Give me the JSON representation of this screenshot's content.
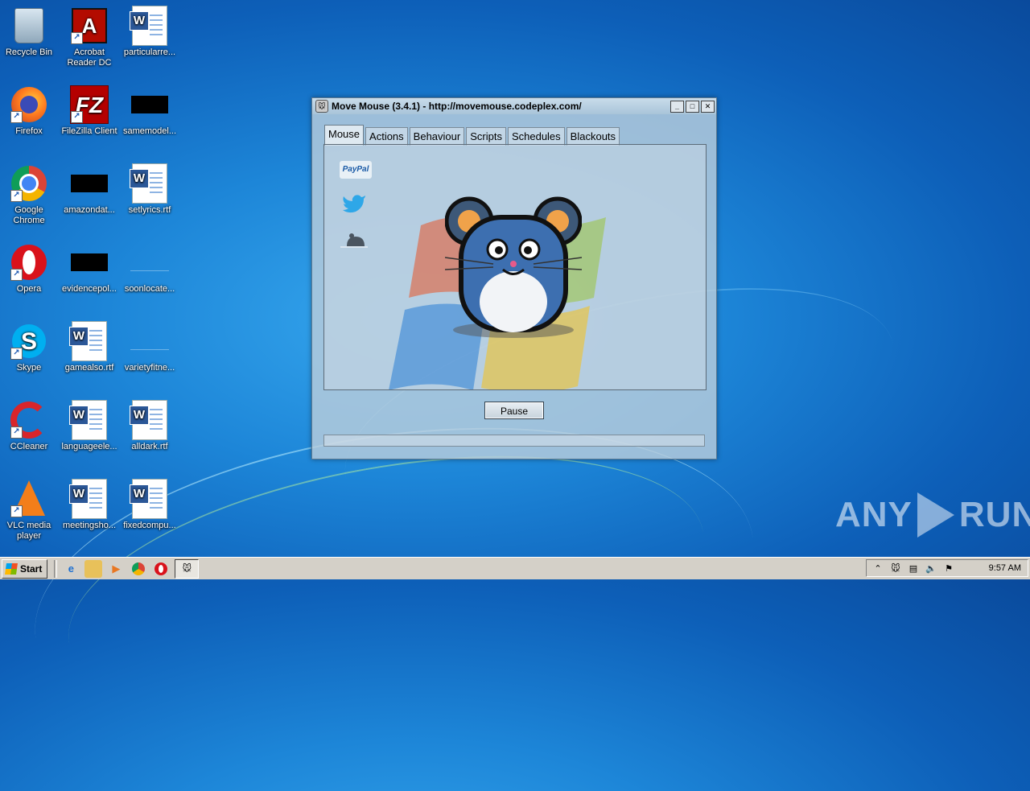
{
  "desktop": {
    "icons": [
      {
        "label": "Recycle Bin",
        "icon": "recycle-bin-icon"
      },
      {
        "label": "Acrobat Reader DC",
        "icon": "acrobat-icon"
      },
      {
        "label": "particularre...",
        "icon": "word-doc-icon"
      },
      {
        "label": "Firefox",
        "icon": "firefox-icon"
      },
      {
        "label": "FileZilla Client",
        "icon": "filezilla-icon"
      },
      {
        "label": "samemodel...",
        "icon": "redacted-icon"
      },
      {
        "label": "Google Chrome",
        "icon": "chrome-icon"
      },
      {
        "label": "amazondat...",
        "icon": "redacted-icon"
      },
      {
        "label": "setlyrics.rtf",
        "icon": "word-doc-icon"
      },
      {
        "label": "Opera",
        "icon": "opera-icon"
      },
      {
        "label": "evidencepol...",
        "icon": "redacted-icon"
      },
      {
        "label": "soonlocate...",
        "icon": "blank-file-icon"
      },
      {
        "label": "Skype",
        "icon": "skype-icon"
      },
      {
        "label": "gamealso.rtf",
        "icon": "word-doc-icon"
      },
      {
        "label": "varietyfitne...",
        "icon": "blank-file-icon"
      },
      {
        "label": "CCleaner",
        "icon": "ccleaner-icon"
      },
      {
        "label": "languageele...",
        "icon": "word-doc-icon"
      },
      {
        "label": "alldark.rtf",
        "icon": "word-doc-icon"
      },
      {
        "label": "VLC media player",
        "icon": "vlc-icon"
      },
      {
        "label": "meetingsho...",
        "icon": "word-doc-icon"
      },
      {
        "label": "fixedcompu...",
        "icon": "word-doc-icon"
      }
    ]
  },
  "window": {
    "title": "Move Mouse (3.4.1) - http://movemouse.codeplex.com/",
    "tabs": [
      "Mouse",
      "Actions",
      "Behaviour",
      "Scripts",
      "Schedules",
      "Blackouts"
    ],
    "active_tab": "Mouse",
    "paypal_label": "PayPal",
    "pause_label": "Pause"
  },
  "taskbar": {
    "start_label": "Start",
    "clock": "9:57 AM"
  },
  "watermark": {
    "left": "ANY",
    "right": "RUN"
  }
}
